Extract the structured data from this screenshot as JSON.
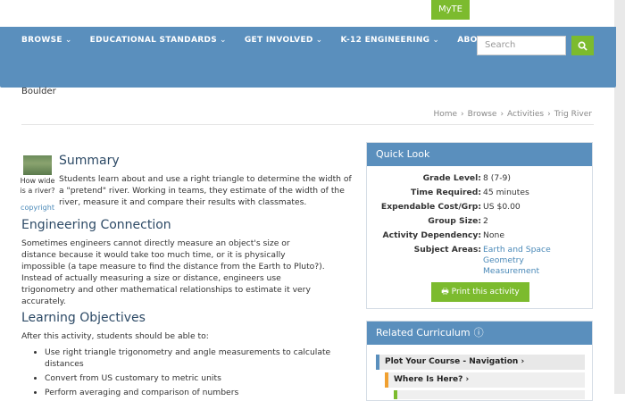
{
  "top": {
    "myte_label": "MyTE"
  },
  "nav": {
    "items": [
      {
        "label": "BROWSE",
        "chev": "⌄"
      },
      {
        "label": "EDUCATIONAL STANDARDS",
        "chev": "⌄"
      },
      {
        "label": "GET INVOLVED",
        "chev": "⌄"
      },
      {
        "label": "K-12 ENGINEERING",
        "chev": "⌄"
      },
      {
        "label": "ABOUT TE",
        "chev": "⌄"
      }
    ],
    "search_placeholder": "Search",
    "search_icon": "search-icon"
  },
  "location": "Boulder",
  "breadcrumb": [
    "Home",
    "Browse",
    "Activities",
    "Trig River"
  ],
  "thumbnail": {
    "caption": "How wide is a river?",
    "copyright": "copyright"
  },
  "summary": {
    "title": "Summary",
    "text": "Students learn about and use a right triangle to determine the width of a \"pretend\" river. Working in teams, they estimate of the width of the river, measure it and compare their results with classmates."
  },
  "engineering": {
    "title": "Engineering Connection",
    "text": "Sometimes engineers cannot directly measure an object's size or distance because it would take too much time, or it is physically impossible (a tape measure to find the distance from the Earth to Pluto?). Instead of actually measuring a size or distance, engineers use trigonometry and other mathematical relationships to estimate it very accurately."
  },
  "objectives": {
    "title": "Learning Objectives",
    "intro": "After this activity, students should be able to:",
    "items": [
      "Use right triangle trigonometry and angle measurements to calculate distances",
      "Convert from US customary to metric units",
      "Perform averaging and comparison of numbers"
    ]
  },
  "quick_look": {
    "title": "Quick Look",
    "rows": [
      {
        "label": "Grade Level:",
        "value": "8 (7-9)"
      },
      {
        "label": "Time Required:",
        "value": "45 minutes"
      },
      {
        "label": "Expendable Cost/Grp:",
        "value": "US $0.00"
      },
      {
        "label": "Group Size:",
        "value": "2"
      },
      {
        "label": "Activity Dependency:",
        "value": "None"
      }
    ],
    "subject_label": "Subject Areas:",
    "subjects": [
      "Earth and Space",
      "Geometry",
      "Measurement"
    ],
    "print_label": "Print this activity"
  },
  "related": {
    "title": "Related Curriculum",
    "items": [
      "Plot Your Course - Navigation",
      "Where Is Here?"
    ]
  },
  "colors": {
    "nav_blue": "#5a8fbd",
    "accent_green": "#7cbb2e",
    "link_blue": "#4a89b8"
  }
}
